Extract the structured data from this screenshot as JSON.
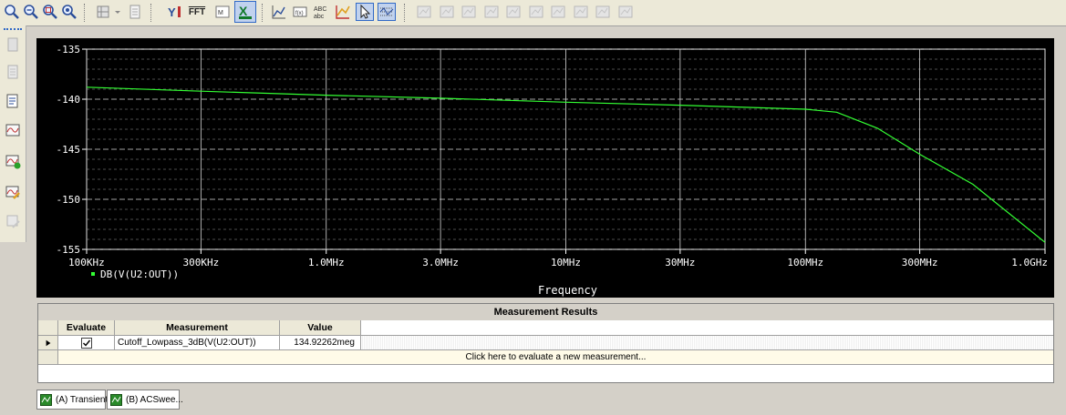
{
  "toolbar": {
    "icons": [
      "zoom-in-icon",
      "zoom-out-icon",
      "zoom-area-icon",
      "zoom-fit-icon",
      "toggle-cursor-icon",
      "copy-icon",
      "y-axis-icon",
      "fft-icon",
      "eval-icon",
      "excel-export-icon",
      "plot-icon",
      "add-trace-icon",
      "text-label-icon",
      "axis-settings-icon",
      "cursor-icon",
      "grid-icon"
    ],
    "fft_label": "FFT"
  },
  "chart_data": {
    "type": "line",
    "x_axis_scale": "log",
    "ylim": [
      -155,
      -135
    ],
    "xlim": [
      "100KHz",
      "1.0GHz"
    ],
    "y_ticks": [
      "-135",
      "-140",
      "-145",
      "-150",
      "-155"
    ],
    "x_ticks": [
      "100KHz",
      "300KHz",
      "1.0MHz",
      "3.0MHz",
      "10MHz",
      "30MHz",
      "100MHz",
      "300MHz",
      "1.0GHz"
    ],
    "xlabel": "Frequency",
    "legend": "DB(V(U2:OUT))",
    "series": [
      {
        "name": "DB(V(U2:OUT))",
        "color": "#33ff33",
        "x_hz": [
          100000,
          300000,
          1000000,
          3000000,
          10000000,
          30000000,
          100000000,
          135000000,
          200000000,
          300000000,
          500000000,
          1000000000
        ],
        "y_db": [
          -138.8,
          -139.2,
          -139.6,
          -139.9,
          -140.3,
          -140.6,
          -141.0,
          -141.3,
          -142.9,
          -145.5,
          -148.5,
          -154.3
        ]
      }
    ]
  },
  "results": {
    "title": "Measurement Results",
    "headers": {
      "evaluate": "Evaluate",
      "measurement": "Measurement",
      "value": "Value"
    },
    "rows": [
      {
        "evaluate_checked": true,
        "measurement": "Cutoff_Lowpass_3dB(V(U2:OUT))",
        "value": "134.92262meg"
      }
    ],
    "new_measurement": "Click here to evaluate a new measurement..."
  },
  "tabs": [
    {
      "label": "(A) Transient"
    },
    {
      "label": "(B) ACSwee..."
    }
  ]
}
